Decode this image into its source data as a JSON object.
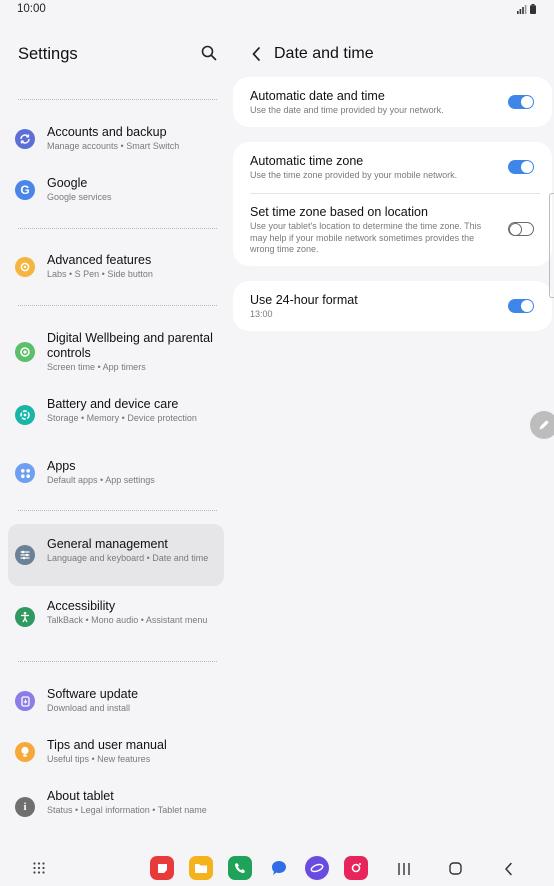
{
  "status_bar": {
    "time": "10:00"
  },
  "left_panel": {
    "title": "Settings",
    "items": [
      {
        "label": "Accounts and backup",
        "sub": "Manage accounts  •  Smart Switch",
        "icon": "sync-icon",
        "color": "#5b6fd6"
      },
      {
        "label": "Google",
        "sub": "Google services",
        "icon": "google-icon",
        "color": "#4a86e8"
      },
      {
        "label": "Advanced features",
        "sub": "Labs  •  S Pen  •  Side button",
        "icon": "gear-plus-icon",
        "color": "#f5b53f"
      },
      {
        "label": "Digital Wellbeing and parental controls",
        "sub": "Screen time  •  App timers",
        "icon": "wellbeing-icon",
        "color": "#5bbf6b"
      },
      {
        "label": "Battery and device care",
        "sub": "Storage  •  Memory  •  Device protection",
        "icon": "device-care-icon",
        "color": "#19b6a6"
      },
      {
        "label": "Apps",
        "sub": "Default apps  •  App settings",
        "icon": "apps-icon",
        "color": "#6e9ff2"
      },
      {
        "label": "General management",
        "sub": "Language and keyboard  •  Date and time",
        "icon": "sliders-icon",
        "color": "#6a8196"
      },
      {
        "label": "Accessibility",
        "sub": "TalkBack  •  Mono audio  •  Assistant menu",
        "icon": "accessibility-icon",
        "color": "#2f9a5f"
      },
      {
        "label": "Software update",
        "sub": "Download and install",
        "icon": "update-icon",
        "color": "#8a7de8"
      },
      {
        "label": "Tips and user manual",
        "sub": "Useful tips  •  New features",
        "icon": "bulb-icon",
        "color": "#f5a93a"
      },
      {
        "label": "About tablet",
        "sub": "Status  •  Legal information  •  Tablet name",
        "icon": "info-icon",
        "color": "#6f6f6f"
      }
    ]
  },
  "right_panel": {
    "title": "Date and time",
    "auto_datetime": {
      "label": "Automatic date and time",
      "sub": "Use the date and time provided by your network.",
      "on": true
    },
    "auto_timezone": {
      "label": "Automatic time zone",
      "sub": "Use the time zone provided by your mobile network.",
      "on": true
    },
    "tz_location": {
      "label": "Set time zone based on location",
      "sub": "Use your tablet's location to determine the time zone. This may help if your mobile network sometimes provides the wrong time zone.",
      "on": false
    },
    "hour24": {
      "label": "Use 24-hour format",
      "sub": "13:00",
      "on": true
    }
  }
}
